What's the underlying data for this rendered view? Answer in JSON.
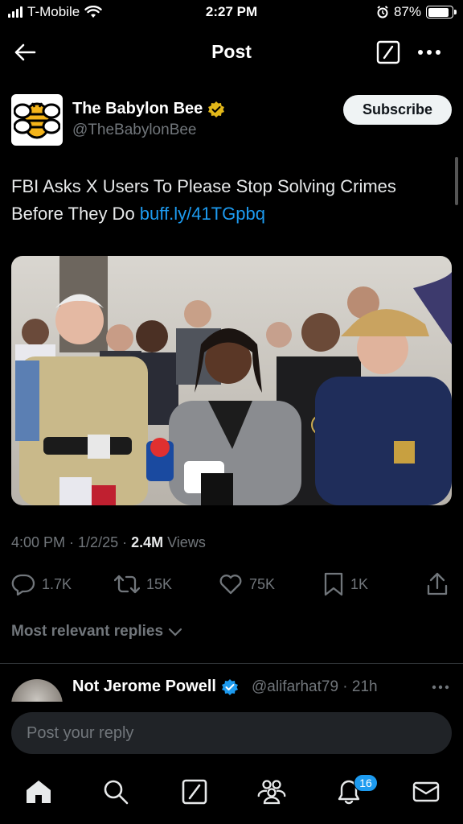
{
  "status_bar": {
    "carrier": "T-Mobile",
    "time": "2:27 PM",
    "battery_percent": "87%",
    "battery_level": 0.87
  },
  "nav": {
    "title": "Post"
  },
  "post": {
    "author_name": "The Babylon Bee",
    "author_handle": "@TheBabylonBee",
    "subscribe_label": "Subscribe",
    "text": "FBI Asks X Users To Please Stop Solving Crimes Before They Do ",
    "link": "buff.ly/41TGpbq",
    "time": "4:00 PM",
    "date": "1/2/25",
    "views_count": "2.4M",
    "views_label": "Views"
  },
  "stats": {
    "replies": "1.7K",
    "reposts": "15K",
    "likes": "75K",
    "bookmarks": "1K"
  },
  "replies_sort_label": "Most relevant replies",
  "reply_preview": {
    "name": "Not Jerome Powell",
    "handle": "@alifarhat79 · 21h"
  },
  "reply_box": {
    "placeholder": "Post your reply"
  },
  "tab_bar": {
    "notifications_badge": "16"
  },
  "colors": {
    "accent": "#1d9bf0",
    "background": "#000000",
    "secondary_text": "#71767b",
    "verified_gold": "#e2b719"
  }
}
